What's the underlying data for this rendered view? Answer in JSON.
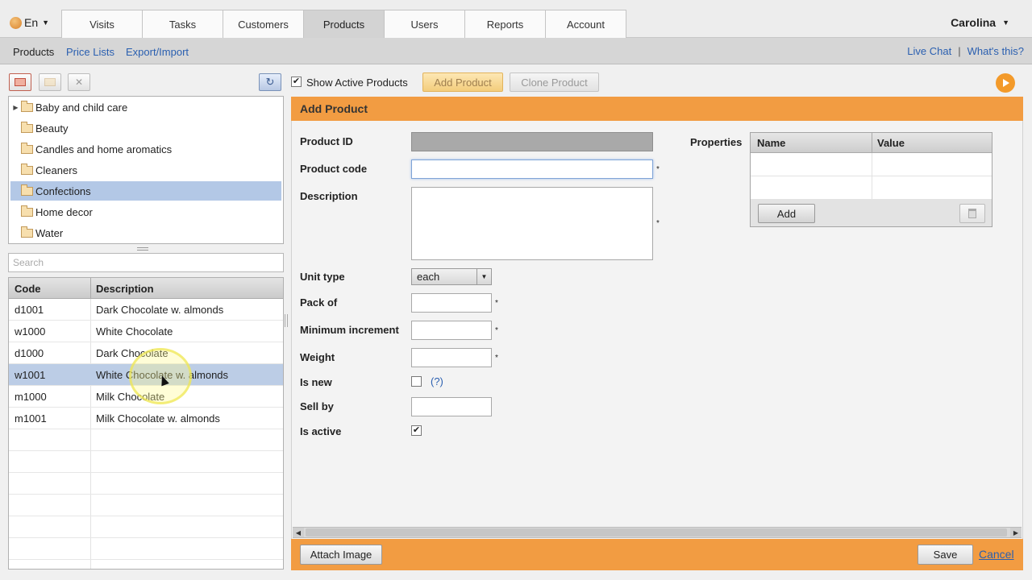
{
  "header": {
    "language": "En",
    "tabs": [
      {
        "label": "Visits"
      },
      {
        "label": "Tasks"
      },
      {
        "label": "Customers"
      },
      {
        "label": "Products"
      },
      {
        "label": "Users"
      },
      {
        "label": "Reports"
      },
      {
        "label": "Account"
      }
    ],
    "active_tab": "Products",
    "user": "Carolina"
  },
  "subnav": {
    "items": [
      {
        "label": "Products"
      },
      {
        "label": "Price Lists"
      },
      {
        "label": "Export/Import"
      }
    ],
    "live_chat": "Live Chat",
    "separator": "|",
    "whats_this": "What's this?"
  },
  "categories": {
    "items": [
      {
        "label": "Baby and child care",
        "expandable": true
      },
      {
        "label": "Beauty"
      },
      {
        "label": "Candles and home aromatics"
      },
      {
        "label": "Cleaners"
      },
      {
        "label": "Confections",
        "selected": true
      },
      {
        "label": "Home decor"
      },
      {
        "label": "Water"
      }
    ]
  },
  "search": {
    "placeholder": "Search",
    "value": ""
  },
  "product_grid": {
    "columns": {
      "code": "Code",
      "description": "Description"
    },
    "rows": [
      {
        "code": "d1001",
        "description": "Dark Chocolate w. almonds"
      },
      {
        "code": "w1000",
        "description": "White Chocolate"
      },
      {
        "code": "d1000",
        "description": "Dark Chocolate"
      },
      {
        "code": "w1001",
        "description": "White Chocolate w. almonds",
        "selected": true
      },
      {
        "code": "m1000",
        "description": "Milk Chocolate"
      },
      {
        "code": "m1001",
        "description": "Milk Chocolate w. almonds"
      }
    ]
  },
  "toolbar": {
    "show_active_label": "Show Active Products",
    "show_active_checked": true,
    "add_product": "Add Product",
    "clone_product": "Clone Product"
  },
  "form": {
    "title": "Add Product",
    "product_id_label": "Product ID",
    "product_code_label": "Product code",
    "description_label": "Description",
    "unit_type_label": "Unit type",
    "unit_type_value": "each",
    "pack_of_label": "Pack of",
    "min_increment_label": "Minimum increment",
    "weight_label": "Weight",
    "is_new_label": "Is new",
    "is_new_checked": false,
    "help_link": "(?)",
    "sell_by_label": "Sell by",
    "is_active_label": "Is active",
    "is_active_checked": true,
    "required_marker": "*",
    "properties_label": "Properties",
    "properties_columns": {
      "name": "Name",
      "value": "Value"
    },
    "properties_add": "Add",
    "attach_image": "Attach Image",
    "save": "Save",
    "cancel": "Cancel"
  },
  "colors": {
    "accent_orange": "#f29c42",
    "selection_blue": "#b3c8e6",
    "link_blue": "#2a5fb0"
  }
}
